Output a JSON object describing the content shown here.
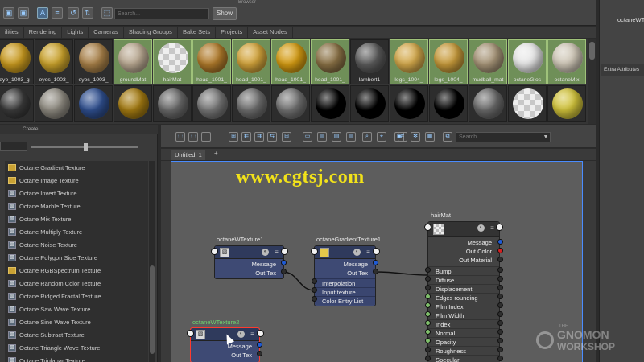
{
  "topbar": {
    "browser_label": "Browser",
    "search_placeholder": "Search...",
    "show_label": "Show"
  },
  "tabs": [
    "ilities",
    "Rendering",
    "Lights",
    "Cameras",
    "Shading Groups",
    "Bake Sets",
    "Projects",
    "Asset Nodes"
  ],
  "swatches_row1": [
    {
      "label": "eye_1003_g",
      "color": "#c99a1f"
    },
    {
      "label": "eyes_1003_",
      "color": "#caa22b"
    },
    {
      "label": "eyes_1003_",
      "color": "#a88048"
    },
    {
      "label": "groundMat",
      "color": "#b9a891"
    },
    {
      "label": "hairMat",
      "color": "checker"
    },
    {
      "label": "head_1001_",
      "color": "#b07a2a"
    },
    {
      "label": "head_1001_",
      "color": "#d2a33a"
    },
    {
      "label": "head_1001_",
      "color": "#d49b12"
    },
    {
      "label": "head_1001_",
      "color": "#8a7145"
    },
    {
      "label": "lambert1",
      "color": "#5c5c5c"
    },
    {
      "label": "legs_1004_",
      "color": "#d3a84a"
    },
    {
      "label": "legs_1004_",
      "color": "#c79a3a"
    },
    {
      "label": "mudball_mat",
      "color": "#a79578"
    },
    {
      "label": "octaneGlos",
      "color": "#e8e8e8"
    },
    {
      "label": "octaneMix",
      "color": "#cfc7b7"
    }
  ],
  "swatches_row2": [
    {
      "color": "#3a3a3a"
    },
    {
      "color": "#8e8a80"
    },
    {
      "color": "#2f4f8f"
    },
    {
      "color": "#a47b12"
    },
    {
      "color": "#6a6a6a"
    },
    {
      "color": "#777777"
    },
    {
      "color": "#6e6e6e"
    },
    {
      "color": "#727272"
    },
    {
      "color": "#000000"
    },
    {
      "color": "#000000"
    },
    {
      "color": "#000000"
    },
    {
      "color": "#000000"
    },
    {
      "color": "#6a6a6a"
    },
    {
      "color": "checker"
    },
    {
      "color": "#d0c23a"
    }
  ],
  "right_panel": {
    "node_name": "octaneWTex",
    "extra_attributes": "Extra Attributes"
  },
  "create_panel": {
    "title": "Create",
    "items": [
      {
        "label": "Octane Gradient Texture",
        "icon": "yellow-texture-icon"
      },
      {
        "label": "Octane Image Texture",
        "icon": "yellow-texture-icon"
      },
      {
        "label": "Octane Invert Texture",
        "icon": "texture-icon"
      },
      {
        "label": "Octane Marble Texture",
        "icon": "texture-icon"
      },
      {
        "label": "Octane Mix Texture",
        "icon": "texture-icon"
      },
      {
        "label": "Octane Multiply Texture",
        "icon": "texture-icon"
      },
      {
        "label": "Octane Noise Texture",
        "icon": "texture-icon"
      },
      {
        "label": "Octane Polygon Side Texture",
        "icon": "texture-icon"
      },
      {
        "label": "Octane RGBSpectrum Texture",
        "icon": "yellow-texture-icon"
      },
      {
        "label": "Octane Random Color Texture",
        "icon": "texture-icon"
      },
      {
        "label": "Octane Ridged Fractal Texture",
        "icon": "texture-icon"
      },
      {
        "label": "Octane Saw Wave Texture",
        "icon": "texture-icon"
      },
      {
        "label": "Octane Sine Wave Texture",
        "icon": "texture-icon"
      },
      {
        "label": "Octane Subtract Texture",
        "icon": "texture-icon"
      },
      {
        "label": "Octane Triangle Wave Texture",
        "icon": "texture-icon"
      },
      {
        "label": "Octane Triplanar Texture",
        "icon": "texture-icon"
      }
    ]
  },
  "node_editor": {
    "search_placeholder": "Search...",
    "tab_label": "Untitled_1",
    "tab_add": "+"
  },
  "watermark": "www.cgtsj.com",
  "nodes": {
    "wtex1": {
      "title": "octaneWTexture1",
      "message": "Message",
      "out": "Out Tex"
    },
    "gradient": {
      "title": "octaneGradientTexture1",
      "message": "Message",
      "out": "Out Tex",
      "inputs": [
        "Interpolation",
        "Input texture",
        "Color Entry List"
      ]
    },
    "wtex2": {
      "title": "octaneWTexture2",
      "message": "Message",
      "out": "Out Tex"
    },
    "hairmat": {
      "title": "hairMat",
      "outputs": [
        "Message",
        "Out Color",
        "Out Material"
      ],
      "inputs": [
        "Bump",
        "Diffuse",
        "Displacement",
        "Edges rounding",
        "Film Index",
        "Film Width",
        "Index",
        "Normal",
        "Opacity",
        "Roughness",
        "Specular"
      ]
    }
  },
  "logo": {
    "line1": "THE",
    "line2": "GNOMON",
    "line3": "WORKSHOP"
  }
}
